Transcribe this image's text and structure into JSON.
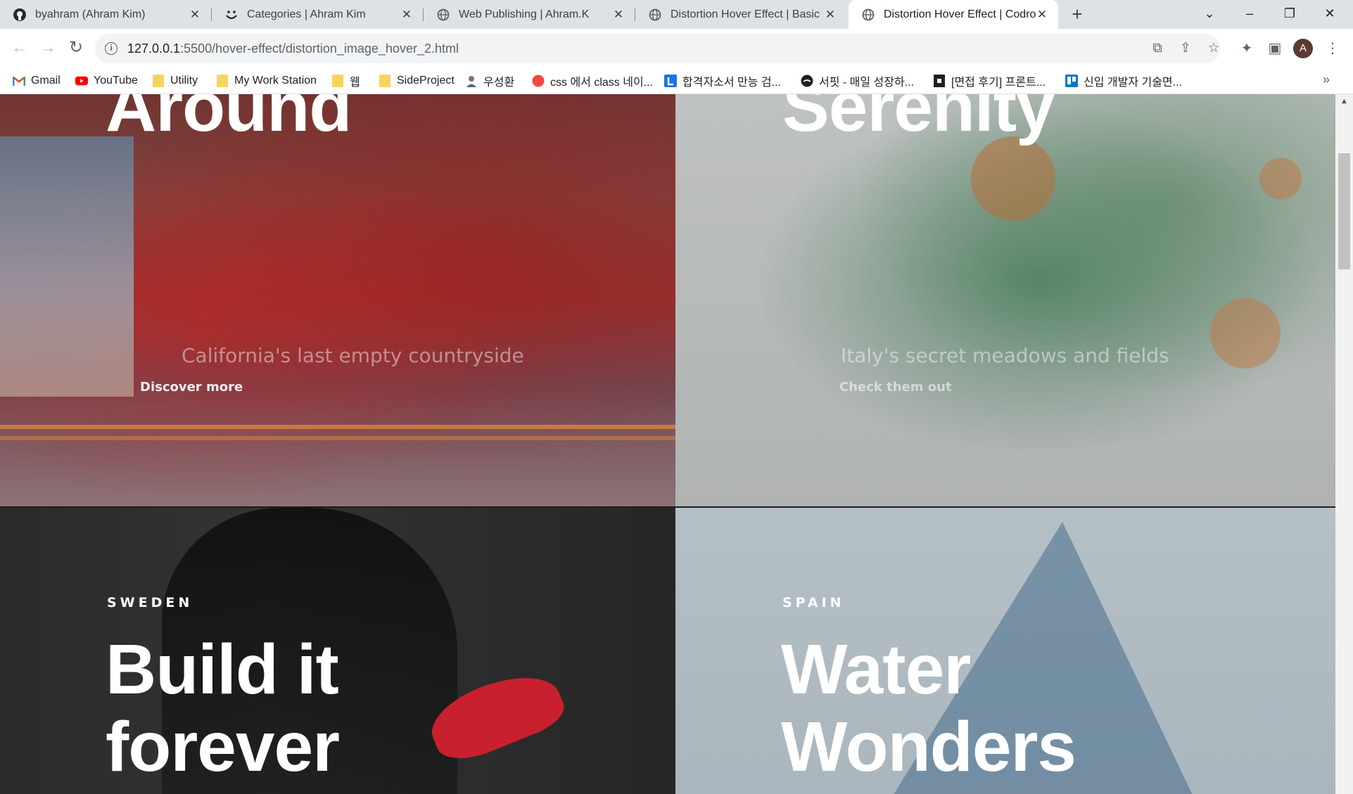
{
  "tabs": [
    {
      "title": "byahram (Ahram Kim)",
      "icon": "github-icon"
    },
    {
      "title": "Categories | Ahram Kim",
      "icon": "smiley-icon"
    },
    {
      "title": "Web Publishing | Ahram.K",
      "icon": "globe-icon"
    },
    {
      "title": "Distortion Hover Effect | Basic",
      "icon": "globe-icon"
    },
    {
      "title": "Distortion Hover Effect | Codrops",
      "icon": "globe-icon",
      "active": true
    }
  ],
  "toolbar": {
    "url_host": "127.0.0.1",
    "url_path": ":5500/hover-effect/distortion_image_hover_2.html",
    "avatar_letter": "A"
  },
  "bookmarks": [
    {
      "label": "Gmail",
      "icon": "gmail-icon"
    },
    {
      "label": "YouTube",
      "icon": "youtube-icon"
    },
    {
      "label": "Utility",
      "icon": "folder-icon"
    },
    {
      "label": "My Work Station",
      "icon": "folder-icon"
    },
    {
      "label": "웹",
      "icon": "folder-icon"
    },
    {
      "label": "SideProject",
      "icon": "folder-icon"
    },
    {
      "label": "우성환",
      "icon": "avatar-icon"
    },
    {
      "label": "css 에서 class 네이...",
      "icon": "red-circle-icon"
    },
    {
      "label": "합격자소서 만능 검...",
      "icon": "l-icon"
    },
    {
      "label": "서핏 - 매일 성장하...",
      "icon": "dark-circle-icon"
    },
    {
      "label": "[면접 후기] 프론트...",
      "icon": "black-square-icon"
    },
    {
      "label": "신입 개발자 기술면...",
      "icon": "trello-icon"
    }
  ],
  "panels": {
    "california": {
      "title": "Around",
      "subtitle": "California's last empty countryside",
      "cta": "Discover more"
    },
    "italy": {
      "title": "Serenity",
      "subtitle": "Italy's secret meadows and fields",
      "cta": "Check them out"
    },
    "sweden": {
      "country": "SWEDEN",
      "title_line1": "Build it",
      "title_line2": "forever"
    },
    "spain": {
      "country": "SPAIN",
      "title_line1": "Water",
      "title_line2": "Wonders"
    }
  },
  "colors": {
    "tabstrip": "#dee1e6",
    "omnibox": "#f1f3f4",
    "heading": "#ffffff"
  }
}
